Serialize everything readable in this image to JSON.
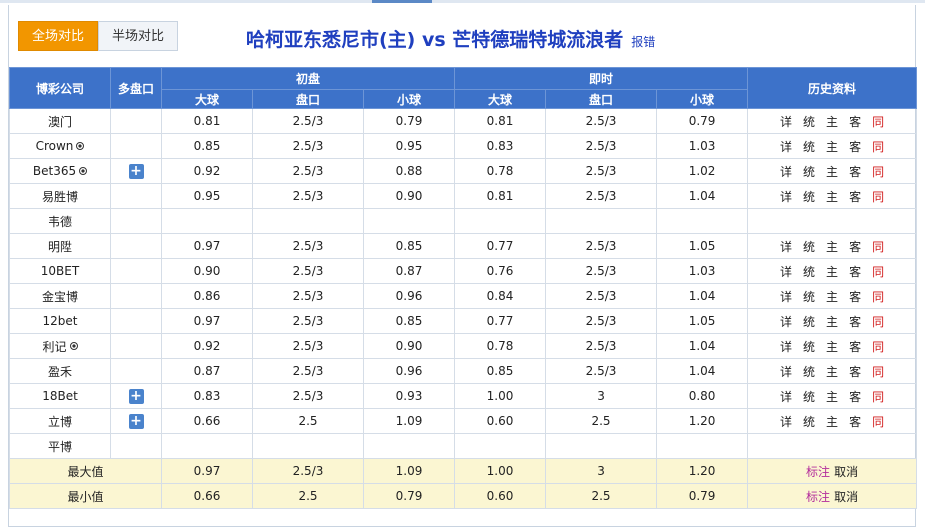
{
  "tabs": [
    {
      "label": "全场对比",
      "active": true
    },
    {
      "label": "半场对比",
      "active": false
    }
  ],
  "title": {
    "match": "哈柯亚东悉尼市(主) vs 芒特德瑞特城流浪者",
    "report": "报错"
  },
  "table": {
    "headers": {
      "company": "博彩公司",
      "multi": "多盘口",
      "initial": "初盘",
      "live": "即时",
      "history": "历史资料",
      "over": "大球",
      "line": "盘口",
      "under": "小球"
    },
    "history_links": [
      "详",
      "统",
      "主",
      "客",
      "同"
    ],
    "rows": [
      {
        "company": "澳门",
        "ball": false,
        "plus": false,
        "init": [
          "0.81",
          "2.5/3",
          "0.79"
        ],
        "live": [
          "0.81",
          "2.5/3",
          "0.79"
        ],
        "history": true
      },
      {
        "company": "Crown",
        "ball": true,
        "plus": false,
        "init": [
          "0.85",
          "2.5/3",
          "0.95"
        ],
        "live": [
          "0.83",
          "2.5/3",
          "1.03"
        ],
        "history": true
      },
      {
        "company": "Bet365",
        "ball": true,
        "plus": true,
        "init": [
          "0.92",
          "2.5/3",
          "0.88"
        ],
        "live": [
          "0.78",
          "2.5/3",
          "1.02"
        ],
        "history": true
      },
      {
        "company": "易胜博",
        "ball": false,
        "plus": false,
        "init": [
          "0.95",
          "2.5/3",
          "0.90"
        ],
        "live": [
          "0.81",
          "2.5/3",
          "1.04"
        ],
        "history": true
      },
      {
        "company": "韦德",
        "ball": false,
        "plus": false,
        "init": [
          "",
          "",
          ""
        ],
        "live": [
          "",
          "",
          ""
        ],
        "history": false
      },
      {
        "company": "明陞",
        "ball": false,
        "plus": false,
        "init": [
          "0.97",
          "2.5/3",
          "0.85"
        ],
        "live": [
          "0.77",
          "2.5/3",
          "1.05"
        ],
        "history": true
      },
      {
        "company": "10BET",
        "ball": false,
        "plus": false,
        "init": [
          "0.90",
          "2.5/3",
          "0.87"
        ],
        "live": [
          "0.76",
          "2.5/3",
          "1.03"
        ],
        "history": true
      },
      {
        "company": "金宝博",
        "ball": false,
        "plus": false,
        "init": [
          "0.86",
          "2.5/3",
          "0.96"
        ],
        "live": [
          "0.84",
          "2.5/3",
          "1.04"
        ],
        "history": true
      },
      {
        "company": "12bet",
        "ball": false,
        "plus": false,
        "init": [
          "0.97",
          "2.5/3",
          "0.85"
        ],
        "live": [
          "0.77",
          "2.5/3",
          "1.05"
        ],
        "history": true
      },
      {
        "company": "利记",
        "ball": true,
        "plus": false,
        "init": [
          "0.92",
          "2.5/3",
          "0.90"
        ],
        "live": [
          "0.78",
          "2.5/3",
          "1.04"
        ],
        "history": true
      },
      {
        "company": "盈禾",
        "ball": false,
        "plus": false,
        "init": [
          "0.87",
          "2.5/3",
          "0.96"
        ],
        "live": [
          "0.85",
          "2.5/3",
          "1.04"
        ],
        "history": true
      },
      {
        "company": "18Bet",
        "ball": false,
        "plus": true,
        "init": [
          "0.83",
          "2.5/3",
          "0.93"
        ],
        "live": [
          "1.00",
          "3",
          "0.80"
        ],
        "history": true
      },
      {
        "company": "立博",
        "ball": false,
        "plus": true,
        "init": [
          "0.66",
          "2.5",
          "1.09"
        ],
        "live": [
          "0.60",
          "2.5",
          "1.20"
        ],
        "history": true
      },
      {
        "company": "平博",
        "ball": false,
        "plus": false,
        "init": [
          "",
          "",
          ""
        ],
        "live": [
          "",
          "",
          ""
        ],
        "history": false
      }
    ],
    "stats": [
      {
        "label": "最大值",
        "init": [
          "0.97",
          "2.5/3",
          "1.09"
        ],
        "live": [
          "1.00",
          "3",
          "1.20"
        ],
        "mark": "标注",
        "cancel": "取消"
      },
      {
        "label": "最小值",
        "init": [
          "0.66",
          "2.5",
          "0.79"
        ],
        "live": [
          "0.60",
          "2.5",
          "0.79"
        ],
        "mark": "标注",
        "cancel": "取消"
      }
    ]
  },
  "colors": {
    "accent_tab": "#f29600",
    "header_bg": "#3d72c9",
    "title": "#1f3fbf",
    "same_link": "#d21d1d",
    "stat_row": "#fbf6d2"
  }
}
